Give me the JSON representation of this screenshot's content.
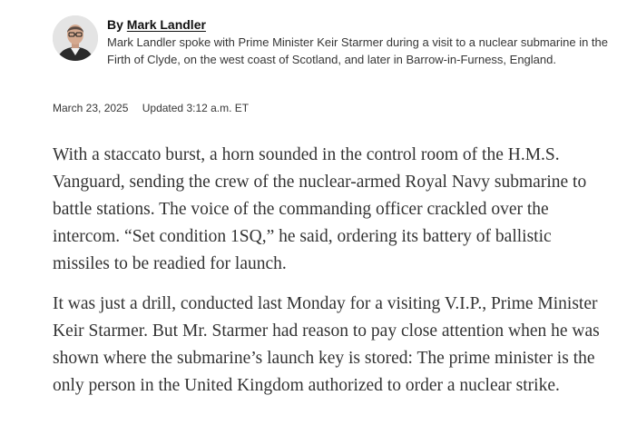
{
  "byline": {
    "prefix": "By",
    "author": "Mark Landler",
    "bio": "Mark Landler spoke with Prime Minister Keir Starmer during a visit to a nuclear submarine in the Firth of Clyde, on the west coast of Scotland, and later in Barrow-in-Furness, England."
  },
  "dates": {
    "published": "March 23, 2025",
    "updated": "Updated 3:12 a.m. ET"
  },
  "article": {
    "paragraphs": [
      "With a staccato burst, a horn sounded in the control room of the H.M.S. Vanguard, sending the crew of the nuclear-armed Royal Navy submarine to battle stations. The voice of the commanding officer crackled over the intercom. “Set condition 1SQ,” he said, ordering its battery of ballistic missiles to be readied for launch.",
      "It was just a drill, conducted last Monday for a visiting V.I.P., Prime Minister Keir Starmer. But Mr. Starmer had reason to pay close attention when he was shown where the submarine’s launch key is stored: The prime minister is the only person in the United Kingdom authorized to order a nuclear strike."
    ]
  }
}
